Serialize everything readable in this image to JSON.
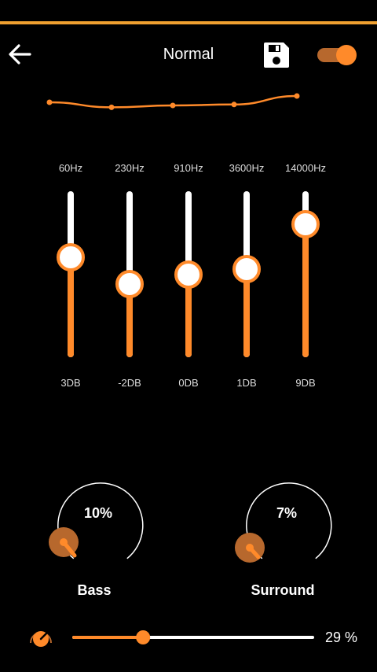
{
  "header": {
    "title": "Normal"
  },
  "toggle": {
    "on": true
  },
  "bands": [
    {
      "freq": "60Hz",
      "db": "3DB",
      "level": 0.6
    },
    {
      "freq": "230Hz",
      "db": "-2DB",
      "level": 0.44
    },
    {
      "freq": "910Hz",
      "db": "0DB",
      "level": 0.5
    },
    {
      "freq": "3600Hz",
      "db": "1DB",
      "level": 0.53
    },
    {
      "freq": "14000Hz",
      "db": "9DB",
      "level": 0.8
    }
  ],
  "effects": {
    "bass": {
      "label": "Bass",
      "percent_text": "10%",
      "value": 0.1
    },
    "surround": {
      "label": "Surround",
      "percent_text": "7%",
      "value": 0.07
    }
  },
  "volume": {
    "percent_text": "29 %",
    "value": 0.29
  },
  "colors": {
    "accent": "#ff8a2a",
    "topline": "#f0a030",
    "background": "#000000",
    "track": "#ffffff"
  },
  "icons": {
    "back": "arrow-left-icon",
    "save": "floppy-disk-icon",
    "volume": "dial-icon"
  }
}
